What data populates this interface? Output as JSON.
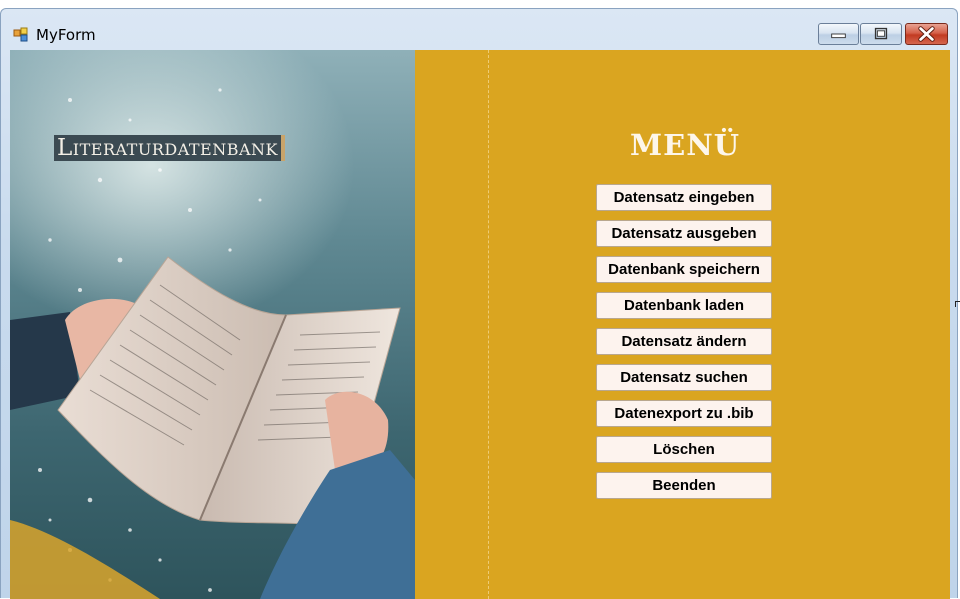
{
  "window": {
    "title": "MyForm"
  },
  "left_panel": {
    "banner_text": "Literaturdatenbank"
  },
  "menu": {
    "title": "MENÜ",
    "buttons": [
      {
        "label": "Datensatz eingeben"
      },
      {
        "label": "Datensatz ausgeben"
      },
      {
        "label": "Datenbank speichern"
      },
      {
        "label": "Datenbank laden"
      },
      {
        "label": "Datensatz ändern"
      },
      {
        "label": "Datensatz suchen"
      },
      {
        "label": "Datenexport zu .bib"
      },
      {
        "label": "Löschen"
      },
      {
        "label": "Beenden"
      }
    ]
  },
  "colors": {
    "client_background": "#daa520",
    "button_background": "#fdf3ee",
    "banner_background": "#3b4a52"
  },
  "icons": [
    "app-icon",
    "minimize-icon",
    "maximize-icon",
    "close-icon"
  ]
}
